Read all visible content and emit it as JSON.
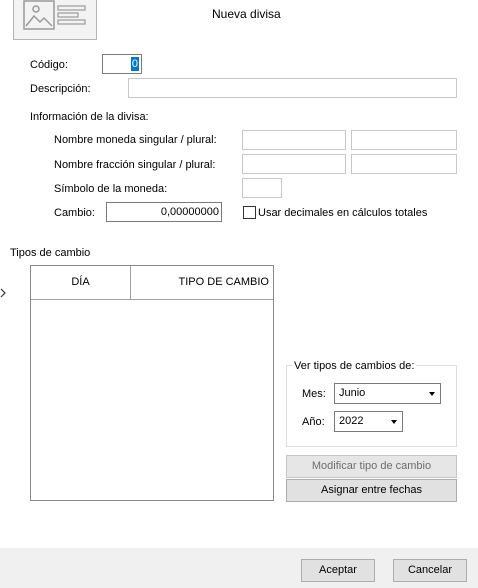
{
  "dialog": {
    "title": "Nueva divisa"
  },
  "form": {
    "codigo_label": "Código:",
    "codigo_value": "0",
    "descripcion_label": "Descripción:",
    "descripcion_value": "",
    "info_section_label": "Información de la divisa:",
    "nombre_moneda_label": "Nombre moneda singular / plural:",
    "nombre_moneda_singular": "",
    "nombre_moneda_plural": "",
    "nombre_fraccion_label": "Nombre fracción singular / plural:",
    "nombre_fraccion_singular": "",
    "nombre_fraccion_plural": "",
    "simbolo_label": "Símbolo de la moneda:",
    "simbolo_value": "",
    "cambio_label": "Cambio:",
    "cambio_value": "0,00000000",
    "usar_decimales_label": "Usar decimales en cálculos totales",
    "usar_decimales_checked": false
  },
  "tipos_cambio": {
    "section_label": "Tipos de cambio",
    "columns": [
      "DÍA",
      "TIPO DE CAMBIO"
    ],
    "rows": []
  },
  "ver_tipos": {
    "group_label": "Ver tipos de cambios de:",
    "mes_label": "Mes:",
    "mes_value": "Junio",
    "ano_label": "Año:",
    "ano_value": "2022"
  },
  "buttons": {
    "modificar": "Modificar tipo de cambio",
    "asignar": "Asignar entre fechas",
    "aceptar": "Aceptar",
    "cancelar": "Cancelar"
  },
  "icons": {
    "header_icon": "id-card-icon",
    "row_pointer": "chevron-right-icon"
  }
}
